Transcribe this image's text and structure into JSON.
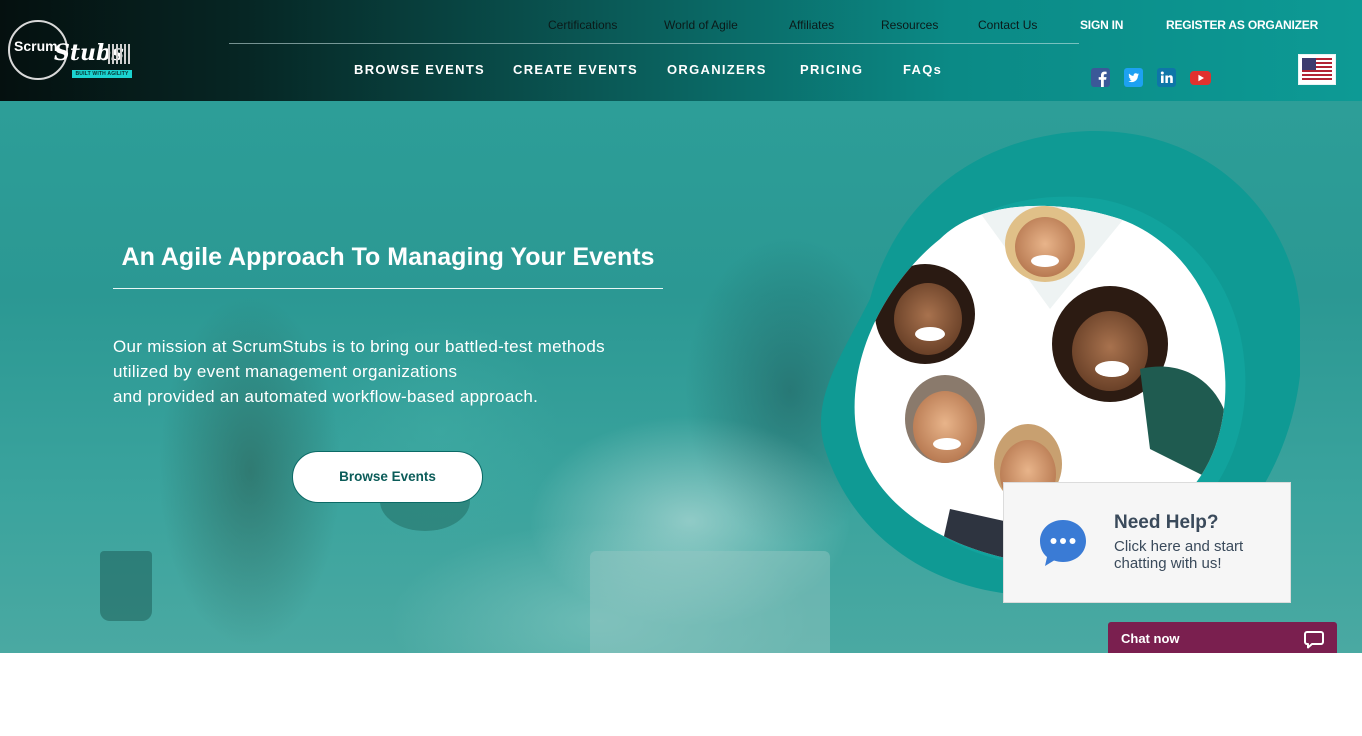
{
  "brand": {
    "logo_word_1": "Scrum",
    "logo_word_2": "Stubs",
    "logo_tagline": "BUILT WITH AGILITY"
  },
  "top_nav": {
    "items": [
      "Certifications",
      "World of Agile",
      "Affiliates",
      "Resources",
      "Contact Us"
    ],
    "sign_in": "SIGN IN",
    "register": "REGISTER AS ORGANIZER"
  },
  "main_nav": {
    "items": [
      "BROWSE EVENTS",
      "CREATE EVENTS",
      "ORGANIZERS",
      "PRICING",
      "FAQs"
    ]
  },
  "social": [
    {
      "name": "facebook-icon",
      "color": "#3b5998"
    },
    {
      "name": "twitter-icon",
      "color": "#1da1f2"
    },
    {
      "name": "linkedin-icon",
      "color": "#0e76a8"
    },
    {
      "name": "youtube-icon",
      "color": "#e0322f"
    }
  ],
  "language": {
    "icon": "us-flag-icon"
  },
  "hero": {
    "title": "An Agile Approach To Managing Your Events",
    "description_lines": [
      "Our mission at ScrumStubs is to bring our battled-test methods",
      "utilized by event management organizations",
      "and provided an automated workflow-based approach."
    ],
    "cta": "Browse Events"
  },
  "help_widget": {
    "title": "Need Help?",
    "subtitle_lines": [
      "Click here and start",
      "chatting with us!"
    ],
    "icon": "chat-bubble-icon"
  },
  "chat_bar": {
    "label": "Chat now",
    "icon": "chat-icon"
  },
  "colors": {
    "teal": "#0d9a95",
    "header_dark": "#05100f",
    "chat_bar": "#7a1f4f",
    "help_text": "#3a4a5b",
    "cta_text": "#0b5c59"
  }
}
